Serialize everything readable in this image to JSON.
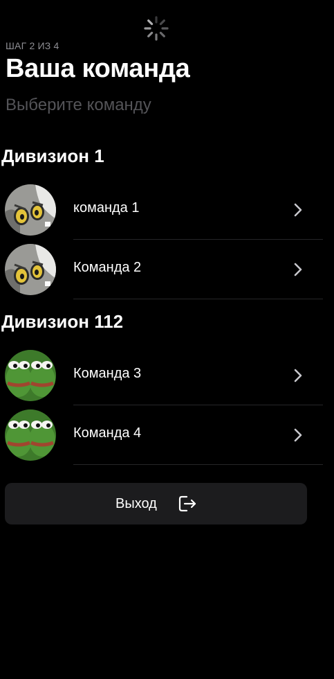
{
  "header": {
    "step": "ШАГ 2 ИЗ 4",
    "title": "Ваша команда",
    "subtitle": "Выберите команду"
  },
  "divisions": [
    {
      "name": "Дивизион 1",
      "teams": [
        {
          "name": "команда 1",
          "avatar": "cartoon-face-avatar"
        },
        {
          "name": "Команда 2",
          "avatar": "cartoon-face-avatar"
        }
      ]
    },
    {
      "name": "Дивизион 112",
      "teams": [
        {
          "name": "Команда 3",
          "avatar": "frog-avatar"
        },
        {
          "name": "Команда 4",
          "avatar": "frog-avatar"
        }
      ]
    }
  ],
  "footer": {
    "logout_label": "Выход",
    "logout_icon": "logout-icon"
  },
  "colors": {
    "background": "#000000",
    "text_primary": "#ffffff",
    "text_secondary": "#8e8e93",
    "button_background": "#1c1c1e",
    "separator": "#262628"
  }
}
